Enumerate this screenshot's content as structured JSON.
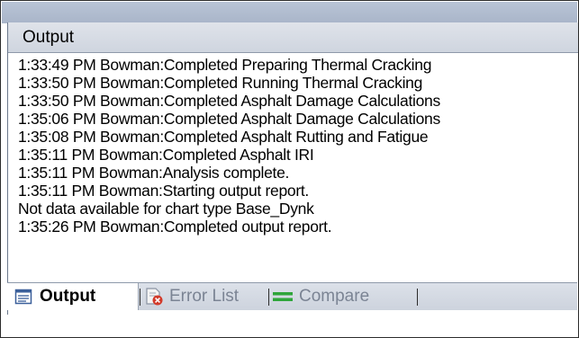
{
  "panel": {
    "title": "Output"
  },
  "log_lines": [
    "1:33:49 PM Bowman:Completed Preparing Thermal Cracking",
    "1:33:50 PM Bowman:Completed Running Thermal Cracking",
    "1:33:50 PM Bowman:Completed Asphalt Damage Calculations",
    "1:35:06 PM Bowman:Completed Asphalt Damage Calculations",
    "1:35:08 PM Bowman:Completed Asphalt Rutting and Fatigue",
    "1:35:11 PM Bowman:Completed Asphalt IRI",
    "1:35:11 PM Bowman:Analysis complete.",
    "1:35:11 PM Bowman:Starting output report.",
    "Not data available for chart type Base_Dynk",
    "1:35:26 PM Bowman:Completed output report."
  ],
  "tabs": [
    {
      "label": "Output",
      "icon": "output-window-icon",
      "active": true
    },
    {
      "label": "Error List",
      "icon": "error-list-icon",
      "active": false
    },
    {
      "label": "Compare",
      "icon": "compare-icon",
      "active": false
    }
  ],
  "colors": {
    "header_bg": "#d6dbe3",
    "tab_inactive_text": "#7b8494",
    "error_red": "#d23a2a",
    "compare_green": "#2ea53a"
  }
}
